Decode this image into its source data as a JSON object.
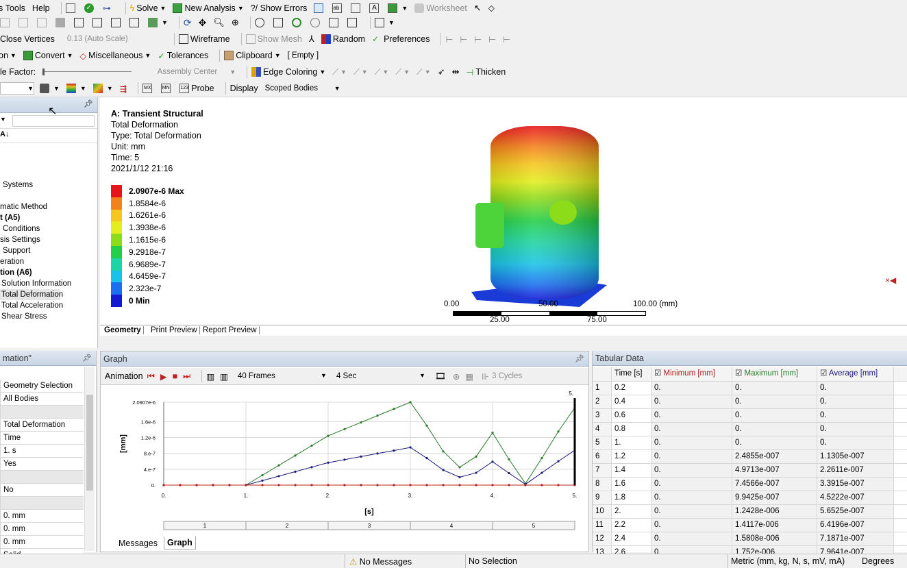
{
  "menu": {
    "tools": "Tools",
    "help": "Help",
    "solve": "Solve",
    "new_analysis": "New Analysis",
    "show_errors": "?/ Show Errors",
    "worksheet": "Worksheet"
  },
  "toolbar3": {
    "close_vertices": "Close Vertices",
    "scale": "0.13 (Auto Scale)",
    "wireframe": "Wireframe",
    "show_mesh": "Show Mesh",
    "random": "Random",
    "preferences": "Preferences"
  },
  "toolbar4": {
    "convert": "Convert",
    "misc": "Miscellaneous",
    "tolerances": "Tolerances",
    "clipboard": "Clipboard",
    "empty": "[ Empty ]"
  },
  "toolbar5": {
    "scale_factor": "le Factor:",
    "assembly_center": "Assembly Center",
    "edge_coloring": "Edge Coloring",
    "thicken": "Thicken"
  },
  "toolbar6": {
    "probe": "Probe",
    "display": "Display",
    "scoped_bodies": "Scoped Bodies"
  },
  "tree": {
    "items": [
      "Systems",
      "matic Method",
      "t (A5)",
      "Conditions",
      "sis Settings",
      "Support",
      "eration",
      "tion (A6)",
      "Solution Information",
      "Total Deformation",
      "Total Acceleration",
      "Shear Stress"
    ]
  },
  "viewport": {
    "title": "A: Transient Structural",
    "line1": "Total Deformation",
    "line2": "Type: Total Deformation",
    "line3": "Unit: mm",
    "line4": "Time: 5",
    "line5": "2021/1/12 21:16",
    "legend": [
      {
        "label": "2.0907e-6 Max",
        "color": "#e8141a"
      },
      {
        "label": "1.8584e-6",
        "color": "#f3821a"
      },
      {
        "label": "1.6261e-6",
        "color": "#f6c61d"
      },
      {
        "label": "1.3938e-6",
        "color": "#e4ee1c"
      },
      {
        "label": "1.1615e-6",
        "color": "#8cdc1a"
      },
      {
        "label": "9.2918e-7",
        "color": "#22cf48"
      },
      {
        "label": "6.9689e-7",
        "color": "#1ed3a5"
      },
      {
        "label": "4.6459e-7",
        "color": "#19c2e8"
      },
      {
        "label": "2.323e-7",
        "color": "#1a6ef0"
      },
      {
        "label": "0 Min",
        "color": "#1419d6"
      }
    ],
    "scale_top": [
      "0.00",
      "50.00",
      "100.00 (mm)"
    ],
    "scale_bottom": [
      "25.00",
      "75.00"
    ],
    "tabs": [
      "Geometry",
      "Print Preview",
      "Report Preview"
    ]
  },
  "details": {
    "title": "mation\"",
    "rows": [
      [
        "",
        "Geometry Selection"
      ],
      [
        "",
        "All Bodies"
      ],
      [
        "",
        ""
      ],
      [
        "",
        "Total Deformation"
      ],
      [
        "",
        "Time"
      ],
      [
        "",
        "1. s"
      ],
      [
        "",
        "Yes"
      ],
      [
        "",
        ""
      ],
      [
        "",
        "No"
      ],
      [
        "",
        ""
      ],
      [
        "",
        "0. mm"
      ],
      [
        "",
        "0. mm"
      ],
      [
        "",
        "0. mm"
      ],
      [
        "",
        "Solid"
      ]
    ]
  },
  "graph": {
    "title": "Graph",
    "animation": "Animation",
    "frames": "40 Frames",
    "duration": "4 Sec",
    "cycles": "3 Cycles",
    "tabs": [
      "Messages",
      "Graph"
    ]
  },
  "chart_data": {
    "type": "line",
    "xlabel": "[s]",
    "ylabel": "[mm]",
    "xlim": [
      0,
      5
    ],
    "ylim": [
      0,
      2.0907e-06
    ],
    "x_ticks": [
      "0.",
      "1.",
      "2.",
      "3.",
      "4.",
      "5."
    ],
    "y_ticks": [
      "0.",
      "4.e-7",
      "8.e-7",
      "1.2e-6",
      "1.6e-6",
      "2.0907e-6"
    ],
    "y_tick_values": [
      0,
      4e-07,
      8e-07,
      1.2e-06,
      1.6e-06,
      2.0907e-06
    ],
    "step_labels": [
      "1",
      "2",
      "3",
      "4",
      "5"
    ],
    "cursor_label": "5.",
    "x": [
      0,
      0.2,
      0.4,
      0.6,
      0.8,
      1,
      1.2,
      1.4,
      1.6,
      1.8,
      2,
      2.2,
      2.4,
      2.6,
      2.8,
      3,
      3.2,
      3.4,
      3.6,
      3.8,
      4,
      4.2,
      4.4,
      4.6,
      4.8,
      5
    ],
    "series": [
      {
        "color": "#2a7a2a",
        "values": [
          0,
          0,
          0,
          0,
          0,
          0,
          2.4855e-07,
          4.9713e-07,
          7.4566e-07,
          9.9425e-07,
          1.2428e-06,
          1.4117e-06,
          1.5808e-06,
          1.752e-06,
          1.92e-06,
          2.0907e-06,
          1.5e-06,
          8.5e-07,
          4.5e-07,
          7.2e-07,
          1.32e-06,
          6.5e-07,
          4e-08,
          6.8e-07,
          1.35e-06,
          1.95e-06
        ]
      },
      {
        "color": "#1a1a7a",
        "values": [
          0,
          0,
          0,
          0,
          0,
          0,
          1.1305e-07,
          2.2611e-07,
          3.3915e-07,
          4.5222e-07,
          5.6525e-07,
          6.4196e-07,
          7.1871e-07,
          7.9641e-07,
          8.7e-07,
          9.5e-07,
          6.8e-07,
          3.8e-07,
          2e-07,
          3.1e-07,
          5.9e-07,
          3e-07,
          2e-08,
          3.1e-07,
          6e-07,
          8.8e-07
        ]
      },
      {
        "color": "#b02020",
        "values": [
          0,
          0,
          0,
          0,
          0,
          0,
          0,
          0,
          0,
          0,
          0,
          0,
          0,
          0,
          0,
          0,
          0,
          0,
          0,
          0,
          0,
          0,
          0,
          0,
          0,
          0
        ]
      }
    ]
  },
  "tabular": {
    "title": "Tabular Data",
    "headers": [
      "Time [s]",
      "Minimum [mm]",
      "Maximum [mm]",
      "Average [mm]"
    ],
    "header_colors": [
      "#000000",
      "#b02020",
      "#2a7a2a",
      "#1a1a7a"
    ],
    "rows": [
      [
        "1",
        "0.2",
        "0.",
        "0.",
        "0."
      ],
      [
        "2",
        "0.4",
        "0.",
        "0.",
        "0."
      ],
      [
        "3",
        "0.6",
        "0.",
        "0.",
        "0."
      ],
      [
        "4",
        "0.8",
        "0.",
        "0.",
        "0."
      ],
      [
        "5",
        "1.",
        "0.",
        "0.",
        "0."
      ],
      [
        "6",
        "1.2",
        "0.",
        "2.4855e-007",
        "1.1305e-007"
      ],
      [
        "7",
        "1.4",
        "0.",
        "4.9713e-007",
        "2.2611e-007"
      ],
      [
        "8",
        "1.6",
        "0.",
        "7.4566e-007",
        "3.3915e-007"
      ],
      [
        "9",
        "1.8",
        "0.",
        "9.9425e-007",
        "4.5222e-007"
      ],
      [
        "10",
        "2.",
        "0.",
        "1.2428e-006",
        "5.6525e-007"
      ],
      [
        "11",
        "2.2",
        "0.",
        "1.4117e-006",
        "6.4196e-007"
      ],
      [
        "12",
        "2.4",
        "0.",
        "1.5808e-006",
        "7.1871e-007"
      ],
      [
        "13",
        "2.6",
        "0.",
        "1.752e-006",
        "7.9641e-007"
      ]
    ]
  },
  "status": {
    "messages": "No Messages",
    "selection": "No Selection",
    "units": "Metric (mm, kg, N, s, mV, mA)",
    "angle": "Degrees"
  }
}
